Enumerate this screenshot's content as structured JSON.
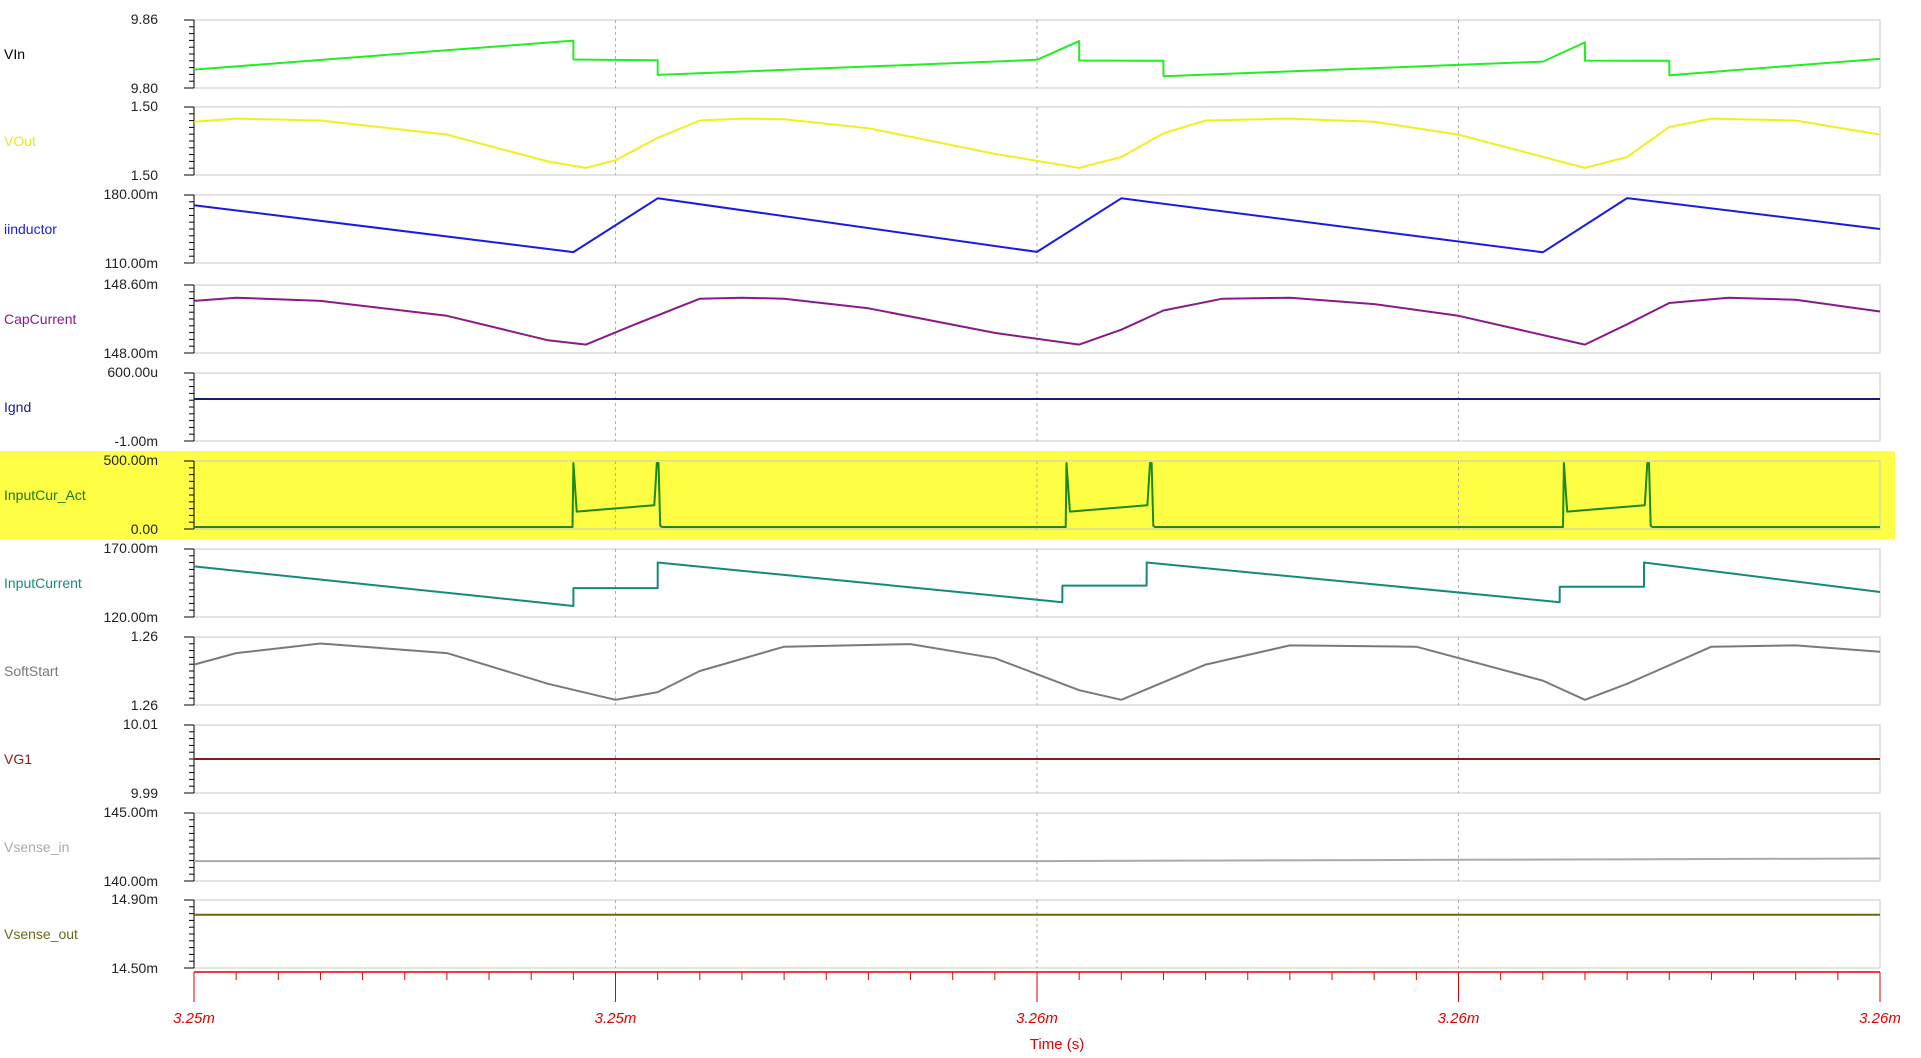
{
  "chart_data": {
    "type": "line",
    "x_ticks": [
      "3.25m",
      "3.25m",
      "3.26m",
      "3.26m",
      "3.26m"
    ],
    "xlabel": "Time (s)",
    "grid": "vertical dashed at major ticks",
    "highlight_color": "#fefe44",
    "axis_color": "#e00000",
    "panels": [
      {
        "name": "VIn",
        "label_color": "#000000",
        "color": "#22ee22",
        "ymax_label": "9.86",
        "ymin_label": "9.80",
        "ylim": [
          9.8,
          9.86
        ],
        "series": {
          "x": [
            0.0,
            0.45,
            0.4501,
            0.55,
            0.5501,
            1.0,
            1.05,
            1.0501,
            1.15,
            1.1501,
            1.6,
            1.65,
            1.6501,
            1.75,
            1.7501,
            2.0
          ],
          "y": [
            9.8154,
            9.8426,
            9.8248,
            9.8241,
            9.8104,
            9.8246,
            9.8421,
            9.8239,
            9.8236,
            9.8091,
            9.8229,
            9.8409,
            9.8238,
            9.8236,
            9.8101,
            9.8254
          ]
        }
      },
      {
        "name": "VOut",
        "label_color": "#e8e820",
        "color": "#f0f020",
        "ymax_label": "1.50",
        "ymin_label": "1.50",
        "ylim": [
          0,
          1
        ],
        "series": {
          "x": [
            0.0,
            0.05,
            0.15,
            0.3,
            0.42,
            0.465,
            0.5,
            0.55,
            0.6,
            0.65,
            0.7,
            0.8,
            0.95,
            1.05,
            1.1,
            1.15,
            1.2,
            1.3,
            1.4,
            1.5,
            1.65,
            1.7,
            1.75,
            1.8,
            1.9,
            2.0
          ],
          "y": [
            0.8,
            0.85,
            0.82,
            0.6,
            0.18,
            0.08,
            0.2,
            0.55,
            0.82,
            0.85,
            0.84,
            0.7,
            0.3,
            0.08,
            0.25,
            0.62,
            0.82,
            0.85,
            0.8,
            0.6,
            0.08,
            0.25,
            0.72,
            0.85,
            0.82,
            0.6
          ]
        }
      },
      {
        "name": "iinductor",
        "label_color": "#1a1ae0",
        "color": "#1a1ae8",
        "ymax_label": "180.00m",
        "ymin_label": "110.00m",
        "ylim": [
          110,
          180
        ],
        "series": {
          "x": [
            0.0,
            0.45,
            0.55,
            1.0,
            1.1,
            1.6,
            1.7,
            2.0
          ],
          "y": [
            171,
            119.7,
            178.6,
            120,
            178.6,
            119.5,
            178.8,
            145
          ]
        }
      },
      {
        "name": "CapCurrent",
        "label_color": "#8a1a8a",
        "color": "#8a1a8a",
        "ymax_label": "148.60m",
        "ymin_label": "148.00m",
        "ylim": [
          148.0,
          148.6
        ],
        "series": {
          "x": [
            0.0,
            0.05,
            0.15,
            0.3,
            0.42,
            0.465,
            0.52,
            0.6,
            0.65,
            0.7,
            0.8,
            0.95,
            1.05,
            1.1,
            1.15,
            1.22,
            1.3,
            1.4,
            1.5,
            1.65,
            1.7,
            1.75,
            1.82,
            1.9,
            2.0
          ],
          "y": [
            148.47,
            148.5,
            148.47,
            148.33,
            148.1,
            148.06,
            148.24,
            148.49,
            148.5,
            148.49,
            148.4,
            148.17,
            148.06,
            148.2,
            148.38,
            148.49,
            148.5,
            148.44,
            148.33,
            148.06,
            148.25,
            148.45,
            148.5,
            148.48,
            148.37
          ]
        }
      },
      {
        "name": "Ignd",
        "label_color": "#1a1a8a",
        "color": "#1a1a7a",
        "ymax_label": "600.00u",
        "ymin_label": "-1.00m",
        "ylim": [
          -1.0,
          0.6
        ],
        "series": {
          "x": [
            0.0,
            2.0
          ],
          "y": [
            0.0,
            0.0
          ]
        }
      },
      {
        "name": "InputCur_Act",
        "label_color": "#1a7a1a",
        "color": "#1a8a1a",
        "ymax_label": "500.00m",
        "ymin_label": "0.00",
        "ylim": [
          0,
          500
        ],
        "highlighted": true,
        "series": {
          "x": [
            0.0,
            0.449,
            0.45,
            0.452,
            0.455,
            0.548,
            0.549,
            0.551,
            0.553,
            0.555,
            2.0
          ],
          "y": [
            0,
            0,
            0,
            500,
            120,
            170,
            500,
            500,
            10,
            0,
            0
          ]
        },
        "bursts": [
          0.45,
          1.035,
          1.625
        ]
      },
      {
        "name": "InputCurrent",
        "label_color": "#1a8a7a",
        "color": "#148a7a",
        "ymax_label": "170.00m",
        "ymin_label": "120.00m",
        "ylim": [
          120,
          170
        ],
        "series": {
          "x": [
            0.0,
            0.45,
            0.4501,
            0.55,
            0.5501,
            1.03,
            1.0301,
            1.13,
            1.1301,
            1.62,
            1.6201,
            1.72,
            1.7201,
            2.0
          ],
          "y": [
            158,
            127,
            141,
            141,
            161,
            130,
            143,
            143,
            161,
            130,
            142,
            142,
            161,
            138
          ]
        }
      },
      {
        "name": "SoftStart",
        "label_color": "#777777",
        "color": "#7a7a7a",
        "ymax_label": "1.26",
        "ymin_label": "1.26",
        "ylim": [
          0,
          1
        ],
        "series": {
          "x": [
            0.0,
            0.05,
            0.15,
            0.3,
            0.42,
            0.5,
            0.55,
            0.6,
            0.7,
            0.85,
            0.95,
            1.05,
            1.1,
            1.2,
            1.3,
            1.45,
            1.6,
            1.65,
            1.7,
            1.8,
            1.9,
            2.0
          ],
          "y": [
            0.6,
            0.78,
            0.93,
            0.78,
            0.3,
            0.05,
            0.17,
            0.5,
            0.88,
            0.92,
            0.7,
            0.2,
            0.05,
            0.6,
            0.9,
            0.88,
            0.35,
            0.05,
            0.3,
            0.88,
            0.9,
            0.8
          ]
        }
      },
      {
        "name": "VG1",
        "label_color": "#8a1a1a",
        "color": "#8a1a1a",
        "ymax_label": "10.01",
        "ymin_label": "9.99",
        "ylim": [
          9.99,
          10.01
        ],
        "series": {
          "x": [
            0.0,
            2.0
          ],
          "y": [
            10.0,
            10.0
          ]
        }
      },
      {
        "name": "Vsense_in",
        "label_color": "#aaaaaa",
        "color": "#aaaaaa",
        "ymax_label": "145.00m",
        "ymin_label": "140.00m",
        "ylim": [
          140,
          145
        ],
        "series": {
          "x": [
            0.0,
            0.5,
            1.0,
            1.5,
            2.0
          ],
          "y": [
            141.4,
            141.4,
            141.4,
            141.5,
            141.6
          ]
        }
      },
      {
        "name": "Vsense_out",
        "label_color": "#6a6a1a",
        "color": "#6a6a10",
        "ymax_label": "14.90m",
        "ymin_label": "14.50m",
        "ylim": [
          14.5,
          14.9
        ],
        "series": {
          "x": [
            0.0,
            2.0
          ],
          "y": [
            14.82,
            14.82
          ]
        }
      }
    ]
  }
}
